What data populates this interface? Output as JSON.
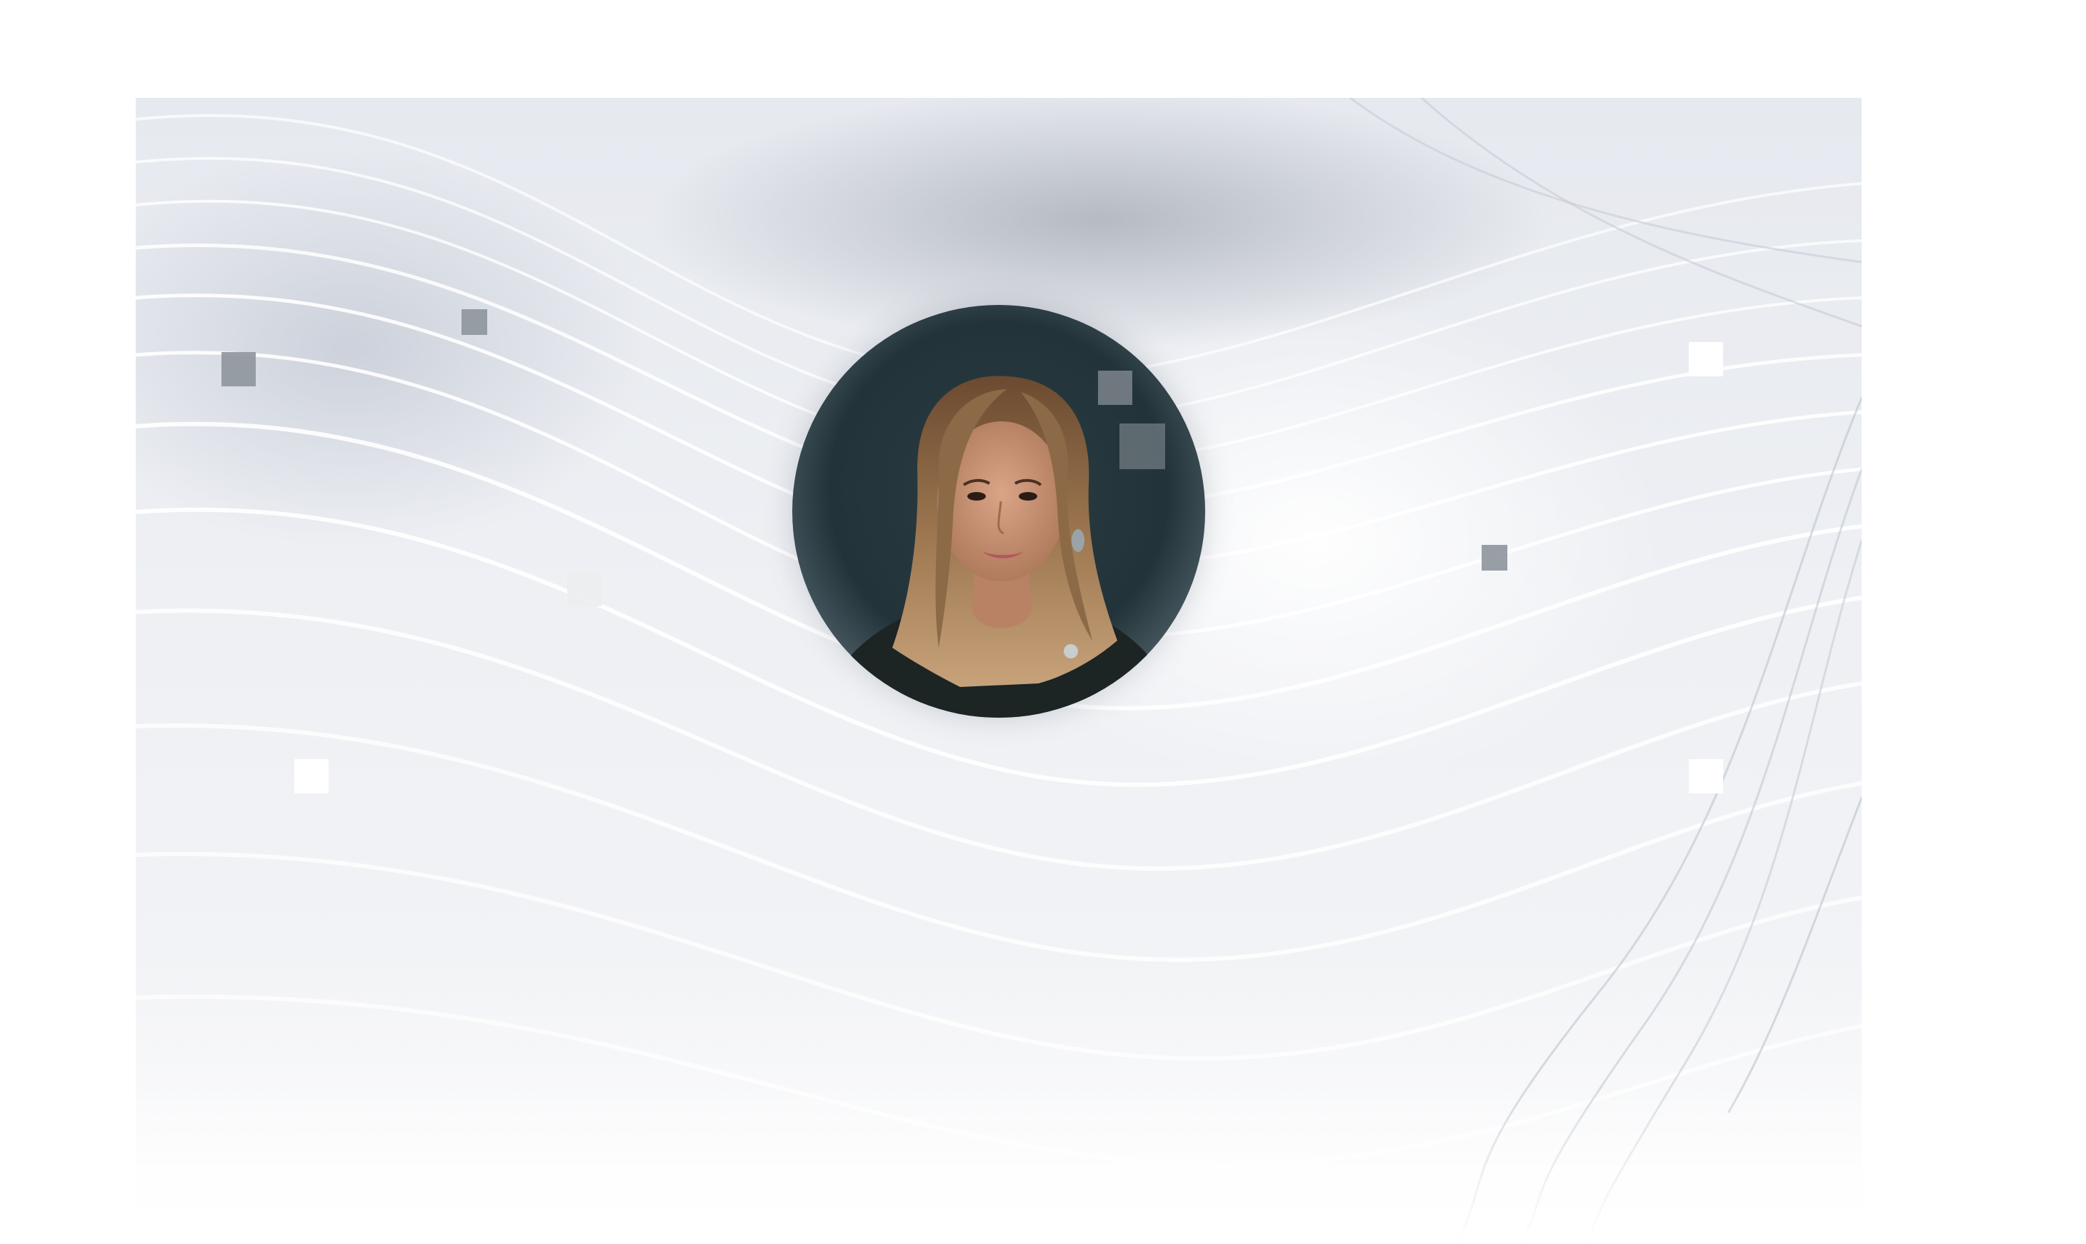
{
  "profile": {
    "photo_icon": "person-portrait-photo"
  },
  "colors": {
    "background": "#ffffff",
    "wave_light": "#f7f8fb",
    "wave_dark": "#b8bfca",
    "square_dark": "#8e959b",
    "square_light": "#ffffff",
    "avatar_backdrop": "#22343a"
  }
}
